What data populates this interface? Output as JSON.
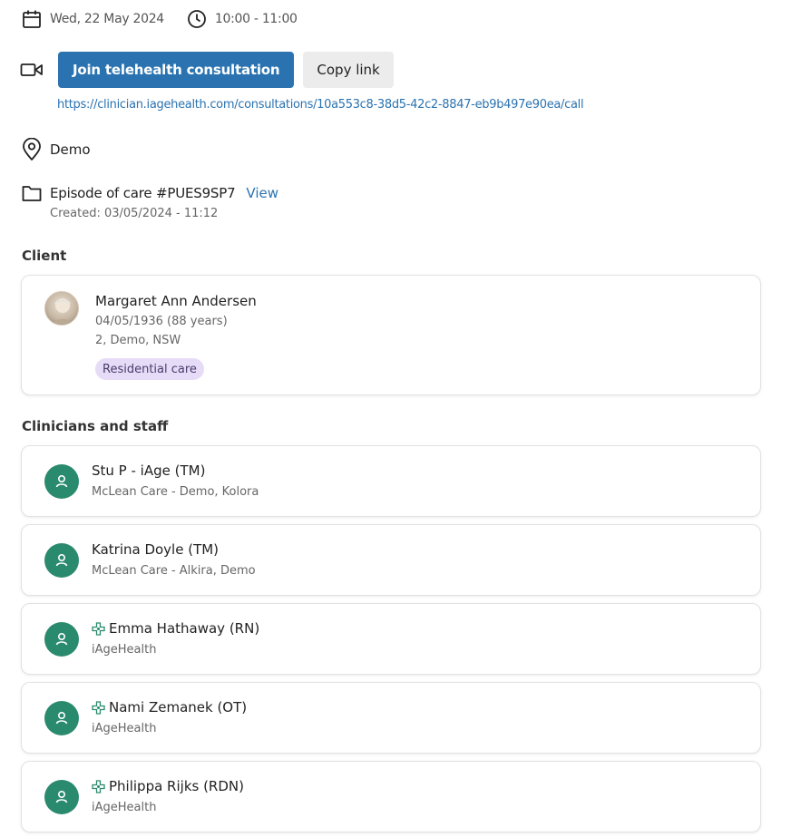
{
  "appointment": {
    "date": "Wed, 22 May 2024",
    "time": "10:00 - 11:00"
  },
  "telehealth": {
    "join_label": "Join telehealth consultation",
    "copy_label": "Copy link",
    "link": "https://clinician.iagehealth.com/consultations/10a553c8-38d5-42c2-8847-eb9b497e90ea/call"
  },
  "location": "Demo",
  "episode": {
    "label": "Episode of care #PUES9SP7",
    "view_label": "View",
    "created": "Created: 03/05/2024 - 11:12"
  },
  "client_section": {
    "title": "Client",
    "name": "Margaret Ann Andersen",
    "dob": "04/05/1936 (88 years)",
    "address": "2, Demo, NSW",
    "badge": "Residential care"
  },
  "staff_section": {
    "title": "Clinicians and staff",
    "members": [
      {
        "name": "Stu P - iAge (TM)",
        "org": "McLean Care - Demo, Kolora",
        "org_mark": false
      },
      {
        "name": "Katrina Doyle (TM)",
        "org": "McLean Care - Alkira, Demo",
        "org_mark": false
      },
      {
        "name": "Emma Hathaway (RN)",
        "org": "iAgeHealth",
        "org_mark": true
      },
      {
        "name": "Nami Zemanek (OT)",
        "org": "iAgeHealth",
        "org_mark": true
      },
      {
        "name": "Philippa Rijks (RDN)",
        "org": "iAgeHealth",
        "org_mark": true
      }
    ]
  },
  "colors": {
    "primary": "#2b73b0",
    "avatar": "#2a8a6e",
    "badge_bg": "#e7dcf8",
    "org_mark": "#2a8a6e"
  },
  "icons": [
    "calendar-icon",
    "clock-icon",
    "video-icon",
    "location-pin-icon",
    "folder-icon",
    "user-icon",
    "org-cross-icon"
  ]
}
